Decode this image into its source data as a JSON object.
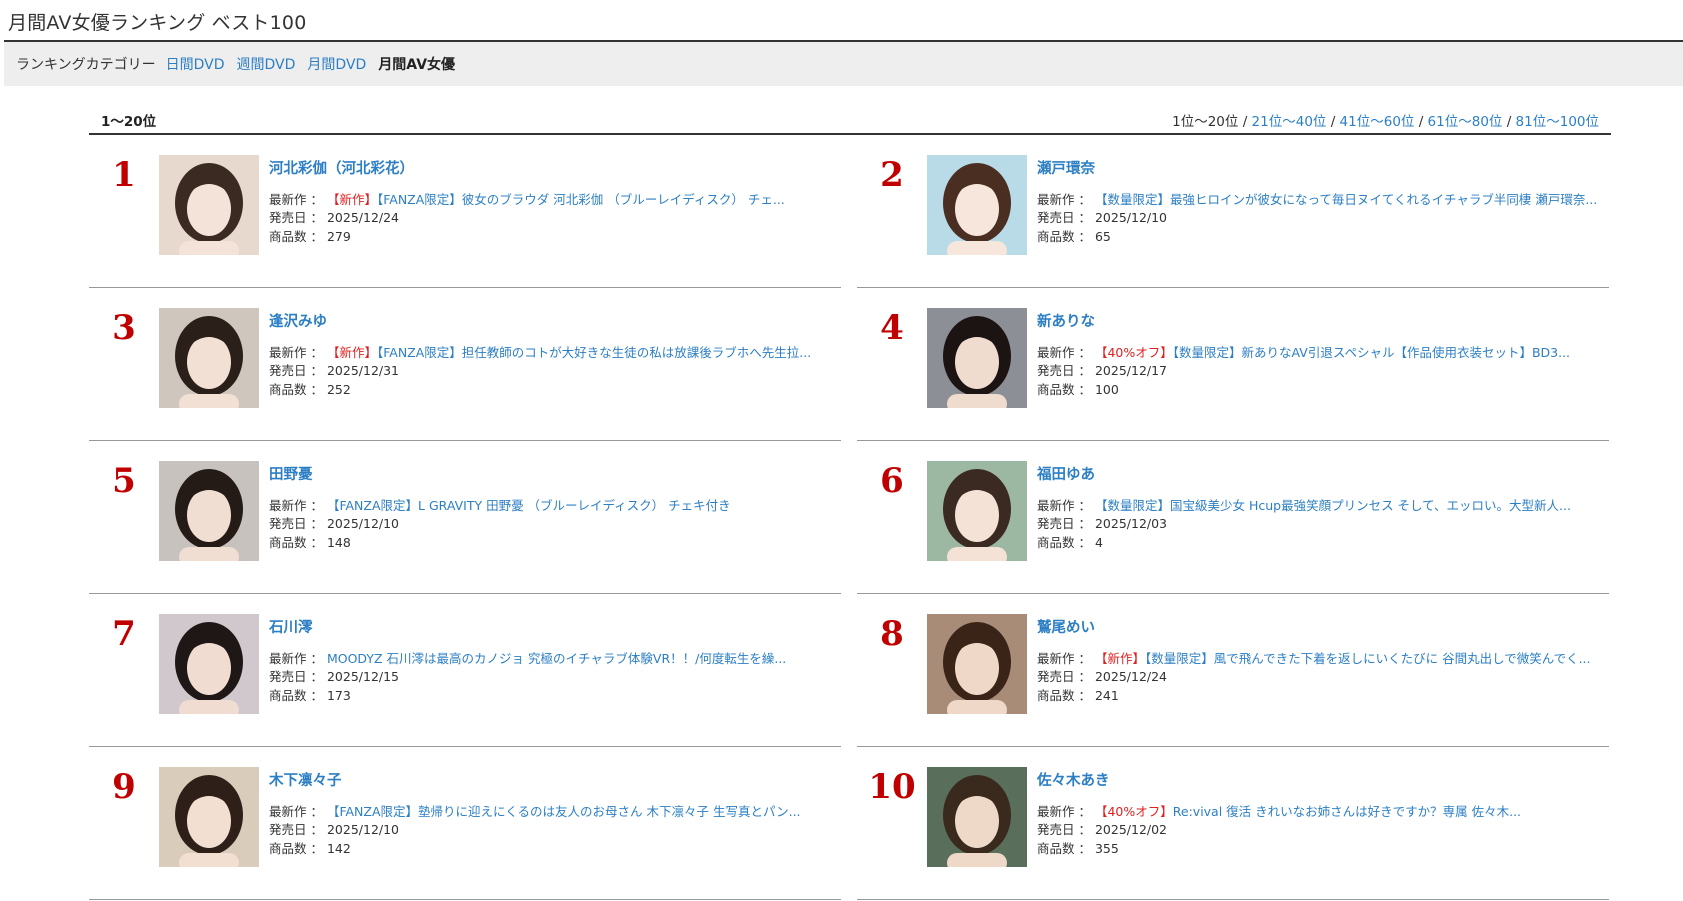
{
  "page_title": "月間AV女優ランキング ベスト100",
  "category_bar": {
    "label": "ランキングカテゴリー",
    "links": [
      "日間DVD",
      "週間DVD",
      "月間DVD"
    ],
    "current": "月間AV女優"
  },
  "range": {
    "current_label": "1〜20位",
    "pager_current": "1位〜20位",
    "separator": " / ",
    "pager_links": [
      "21位〜40位",
      "41位〜60位",
      "61位〜80位",
      "81位〜100位"
    ]
  },
  "labels": {
    "latest": "最新作 ：",
    "release": "発売日 ：",
    "count": "商品数 ："
  },
  "entries": [
    {
      "rank": "1",
      "name": "河北彩伽（河北彩花）",
      "badge": "【新作】",
      "latest": "【FANZA限定】彼女のブラウダ 河北彩伽 （ブルーレイディスク） チェ...",
      "release": "2025/12/24",
      "count": "279"
    },
    {
      "rank": "2",
      "name": "瀬戸環奈",
      "badge": "",
      "latest": "【数量限定】最強ヒロインが彼女になって毎日ヌイてくれるイチャラブ半同棲 瀬戸環奈...",
      "release": "2025/12/10",
      "count": "65"
    },
    {
      "rank": "3",
      "name": "逢沢みゆ",
      "badge": "【新作】",
      "latest": "【FANZA限定】担任教師のコトが大好きな生徒の私は放課後ラブホへ先生拉...",
      "release": "2025/12/31",
      "count": "252"
    },
    {
      "rank": "4",
      "name": "新ありな",
      "badge": "【40%オフ】",
      "latest": "【数量限定】新ありなAV引退スペシャル【作品使用衣装セット】BD3...",
      "release": "2025/12/17",
      "count": "100"
    },
    {
      "rank": "5",
      "name": "田野憂",
      "badge": "",
      "latest": "【FANZA限定】L GRAVITY 田野憂 （ブルーレイディスク） チェキ付き",
      "release": "2025/12/10",
      "count": "148"
    },
    {
      "rank": "6",
      "name": "福田ゆあ",
      "badge": "",
      "latest": "【数量限定】国宝級美少女 Hcup最強笑顔プリンセス そして、エッロい。大型新人...",
      "release": "2025/12/03",
      "count": "4"
    },
    {
      "rank": "7",
      "name": "石川澪",
      "badge": "",
      "latest": "MOODYZ 石川澪は最高のカノジョ 究極のイチャラブ体験VR！！/何度転生を繰...",
      "release": "2025/12/15",
      "count": "173"
    },
    {
      "rank": "8",
      "name": "鷲尾めい",
      "badge": "【新作】",
      "latest": "【数量限定】風で飛んできた下着を返しにいくたびに 谷間丸出しで微笑んでく...",
      "release": "2025/12/24",
      "count": "241"
    },
    {
      "rank": "9",
      "name": "木下凛々子",
      "badge": "",
      "latest": "【FANZA限定】塾帰りに迎えにくるのは友人のお母さん 木下凛々子 生写真とパン...",
      "release": "2025/12/10",
      "count": "142"
    },
    {
      "rank": "10",
      "name": "佐々木あき",
      "badge": "【40%オフ】",
      "latest": "Re:vival 復活 きれいなお姉さんは好きですか？専属 佐々木...",
      "release": "2025/12/02",
      "count": "355"
    }
  ],
  "colors": {
    "link": "#2c7fc4",
    "rank": "#c00000",
    "badge": "#e02020",
    "category_bg": "#eeeeee"
  }
}
